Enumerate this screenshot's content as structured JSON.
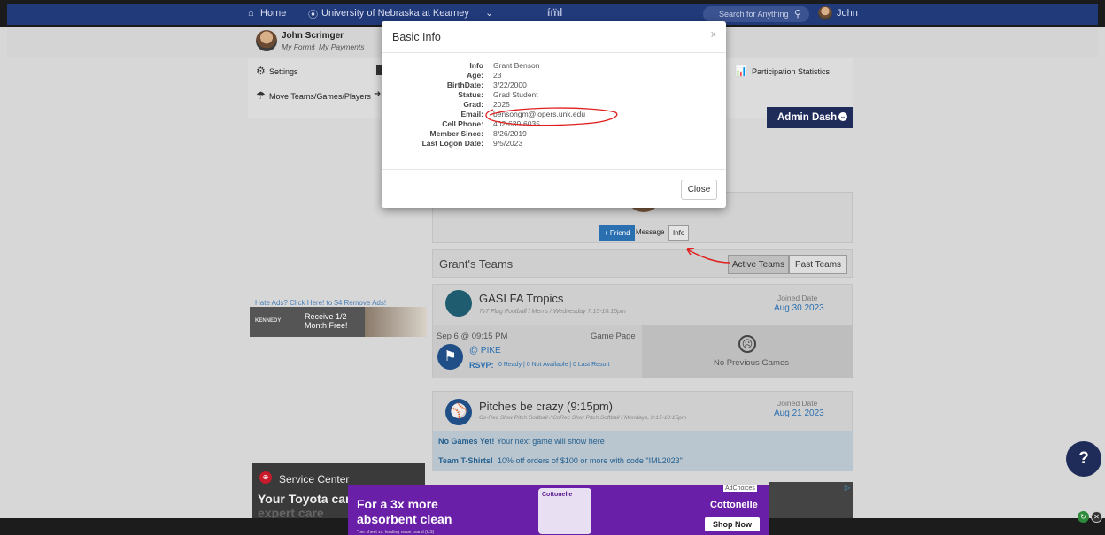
{
  "nav": {
    "home": "Home",
    "school": "University of Nebraska at Kearney",
    "logo": "imleagues",
    "search_placeholder": "Search for Anything",
    "user": "John"
  },
  "profile": {
    "name": "John Scrimger",
    "my_forms": "My Forms",
    "sep": "/",
    "my_payments": "My Payments"
  },
  "panel": {
    "settings": "Settings",
    "move": "Move Teams/Games/Players",
    "stats": "Participation Statistics"
  },
  "admin_dash": "Admin Dash",
  "player_actions": {
    "friend": "+ Friend",
    "message": "Message",
    "info": "Info"
  },
  "teams": {
    "title": "Grant's Teams",
    "active": "Active Teams",
    "past": "Past Teams"
  },
  "team1": {
    "name": "GASLFA Tropics",
    "league": "7v7 Flag Football / Men's / Wednesday 7:15-10:15pm",
    "joined_label": "Joined Date",
    "joined": "Aug 30 2023",
    "game_time": "Sep 6 @ 09:15 PM",
    "game_page": "Game Page",
    "opponent": "@ PIKE",
    "rsvp": "RSVP:",
    "rsvp_detail": "0 Ready | 0 Not Available | 0 Last Resort",
    "no_prev": "No Previous Games"
  },
  "team2": {
    "name": "Pitches be crazy (9:15pm)",
    "league": "Co-Rec Slow Pitch Softball / CoRec Slow Pitch Softball / Mondays, 8:15-10:15pm",
    "joined_label": "Joined Date",
    "joined": "Aug 21 2023",
    "no_games_bold": "No Games Yet!",
    "no_games": "Your next game will show here",
    "tshirt_bold": "Team T-Shirts!",
    "tshirt": "10% off orders of $100 or more with code \"IML2023\""
  },
  "ads": {
    "hate": "Hate Ads? Click Here! to $4 Remove Ads!",
    "kennedy_logo": "KENNEDY",
    "kennedy_text": "Receive 1/2 Month Free!",
    "service": "Service Center",
    "toyota1": "Your Toyota care",
    "toyota2": "expert care",
    "adchoices": "AdChoices",
    "cotton_head1": "For a 3x more",
    "cotton_head2": "absorbent clean",
    "cotton_fine": "*per sheet vs. leading value brand (US)",
    "cotton_brand": "Cottonelle",
    "shop": "Shop Now"
  },
  "modal": {
    "title": "Basic Info",
    "close_x": "x",
    "rows": [
      {
        "label": "Info",
        "value": "Grant Benson"
      },
      {
        "label": "Age:",
        "value": "23"
      },
      {
        "label": "BirthDate:",
        "value": "3/22/2000"
      },
      {
        "label": "Status:",
        "value": "Grad Student"
      },
      {
        "label": "Grad:",
        "value": "2025"
      },
      {
        "label": "Email:",
        "value": "bensongm@lopers.unk.edu"
      },
      {
        "label": "Cell Phone:",
        "value": "402-639-6035"
      },
      {
        "label": "Member Since:",
        "value": "8/26/2019"
      },
      {
        "label": "Last Logon Date:",
        "value": "9/5/2023"
      }
    ],
    "close_button": "Close"
  },
  "help": "?",
  "colors": {
    "nav": "#213a7a",
    "accent": "#2a6fb0",
    "admin": "#1f2c5a",
    "cottonelle": "#6a1fa8",
    "annotation": "#e02020"
  }
}
